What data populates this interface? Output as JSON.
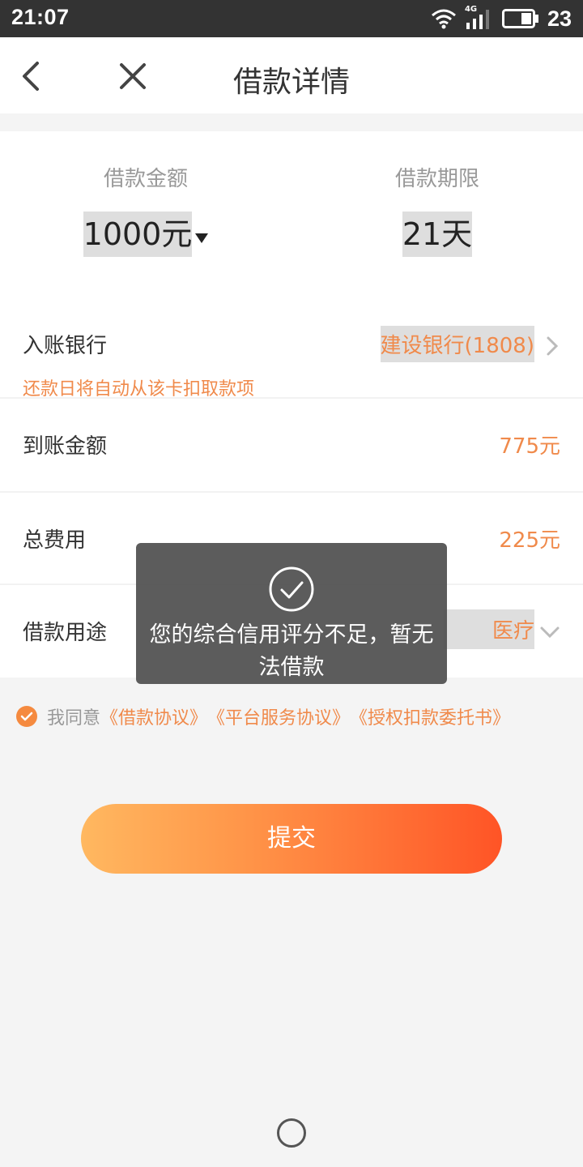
{
  "status_bar": {
    "time": "21:07",
    "network": "4G",
    "battery": "23"
  },
  "header": {
    "title": "借款详情"
  },
  "loan": {
    "amount_label": "借款金额",
    "amount_value": "1000元",
    "term_label": "借款期限",
    "term_value": "21天"
  },
  "rows": {
    "bank_label": "入账银行",
    "bank_value": "建设银行(1808)",
    "bank_hint": "还款日将自动从该卡扣取款项",
    "received_label": "到账金额",
    "received_value": "775元",
    "fee_label": "总费用",
    "fee_value": "225元",
    "purpose_label": "借款用途",
    "purpose_value": "医疗"
  },
  "agreement": {
    "prefix": "我同意",
    "links": [
      "《借款协议》",
      "《平台服务协议》",
      "《授权扣款委托书》"
    ]
  },
  "submit_label": "提交",
  "toast": {
    "message": "您的综合信用评分不足，暂无法借款"
  },
  "colors": {
    "accent": "#f08a4b",
    "status_bar": "#333333",
    "button_start": "#ffb860",
    "button_end": "#ff5426"
  }
}
